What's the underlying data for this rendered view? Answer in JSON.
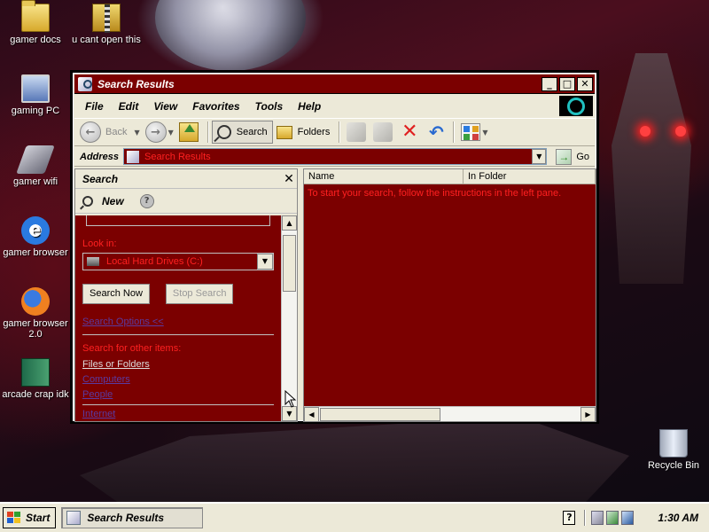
{
  "desktop": {
    "icons": [
      {
        "label": "gamer docs",
        "icon": "folder-icon"
      },
      {
        "label": "u cant open this",
        "icon": "zip-folder-icon"
      },
      {
        "label": "gaming PC",
        "icon": "computer-icon"
      },
      {
        "label": "gamer wifi",
        "icon": "network-icon"
      },
      {
        "label": "gamer browser",
        "icon": "internet-explorer-icon"
      },
      {
        "label": "gamer browser 2.0",
        "icon": "firefox-icon"
      },
      {
        "label": "arcade crap idk",
        "icon": "book-icon"
      },
      {
        "label": "Recycle Bin",
        "icon": "recycle-bin-icon"
      }
    ]
  },
  "window": {
    "title": "Search Results",
    "menu": [
      "File",
      "Edit",
      "View",
      "Favorites",
      "Tools",
      "Help"
    ],
    "toolbar": {
      "back": "Back",
      "search": "Search",
      "folders": "Folders"
    },
    "address": {
      "label": "Address",
      "value": "Search Results",
      "go": "Go"
    },
    "left_pane": {
      "title": "Search",
      "new": "New",
      "look_in_label": "Look in:",
      "look_in_value": "Local Hard Drives (C:)",
      "search_now": "Search Now",
      "stop_search": "Stop Search",
      "search_options": "Search Options <<",
      "other_items_label": "Search for other items:",
      "links": [
        "Files or Folders",
        "Computers",
        "People",
        "Internet"
      ]
    },
    "right_pane": {
      "columns": [
        "Name",
        "In Folder"
      ],
      "message": "To start your search, follow the instructions in the left pane."
    }
  },
  "taskbar": {
    "start": "Start",
    "task": "Search Results",
    "help": "?",
    "clock": "1:30 AM"
  },
  "colors": {
    "pane_bg": "#7b0000",
    "pane_text": "#ff2020",
    "chrome": "#ece9d8"
  }
}
